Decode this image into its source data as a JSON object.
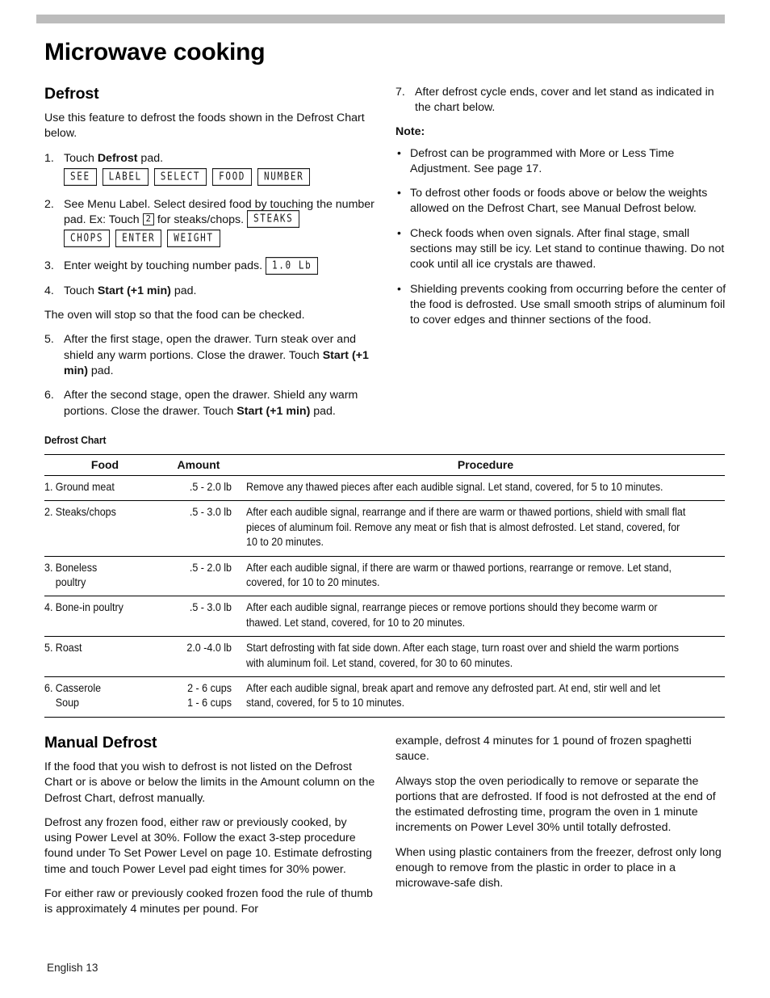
{
  "page_title": "Microwave cooking",
  "footer": "English 13",
  "defrost": {
    "heading": "Defrost",
    "intro": "Use this feature to defrost the foods shown in the Defrost Chart below.",
    "steps": [
      {
        "num": "1.",
        "text_before": "Touch ",
        "bold": "Defrost",
        "text_after": " pad."
      },
      {
        "num": "2.",
        "text": "See Menu Label. Select desired food by touching the number pad. Ex: Touch",
        "keycap": "2",
        "text2": "for steaks/chops."
      },
      {
        "num": "3.",
        "text": "Enter weight by touching number pads."
      },
      {
        "num": "4.",
        "text_before": "Touch ",
        "bold": "Start (+1 min)",
        "text_after": " pad."
      },
      {
        "num": "5.",
        "text_before": "After the first stage, open the drawer. Turn steak over and shield any warm portions. Close the drawer. Touch ",
        "bold": "Start (+1 min)",
        "text_after": " pad."
      },
      {
        "num": "6.",
        "text_before": "After the second stage, open the drawer. Shield any warm portions. Close the drawer. Touch ",
        "bold": "Start (+1 min)",
        "text_after": " pad."
      },
      {
        "num": "7.",
        "text": "After defrost cycle ends, cover and let stand as indicated in the chart below."
      }
    ],
    "after_step4": "The oven will stop so that the food can be checked.",
    "lcd_row1": [
      "SEE",
      "LABEL",
      "SELECT",
      "FOOD",
      "NUMBER"
    ],
    "lcd_steaks": "STEAKS",
    "lcd_row2": [
      "CHOPS",
      "ENTER",
      "WEIGHT"
    ],
    "lcd_weight": "1.0 Lb"
  },
  "note": {
    "heading": "Note:",
    "bullets": [
      "Defrost can be programmed with More or Less Time Adjustment. See page 17.",
      "To defrost other foods or foods above or below the weights allowed on the Defrost Chart, see Manual Defrost below.",
      "Check foods when oven signals. After final stage, small sections may still be icy. Let stand to continue thawing. Do not cook until all ice crystals are thawed.",
      "Shielding prevents cooking from occurring before the center of the food is defrosted. Use small smooth strips of aluminum foil to cover edges and thinner sections of the food."
    ]
  },
  "chart": {
    "title": "Defrost Chart",
    "columns": [
      "Food",
      "Amount",
      "Procedure"
    ],
    "rows": [
      {
        "num": "1.",
        "food": "Ground meat",
        "food_line2": "",
        "amount": ".5 - 2.0 lb",
        "amount_line2": "",
        "procedure": "Remove any thawed pieces after each audible signal. Let stand, covered, for 5 to 10 minutes."
      },
      {
        "num": "2.",
        "food": "Steaks/chops",
        "food_line2": "",
        "amount": ".5 - 3.0 lb",
        "amount_line2": "",
        "procedure": "After each audible signal, rearrange and if there are warm or thawed portions, shield with small flat pieces of aluminum foil. Remove any meat or fish that is almost defrosted. Let stand, covered, for 10 to 20 minutes."
      },
      {
        "num": "3.",
        "food": "Boneless",
        "food_line2": "poultry",
        "amount": ".5 - 2.0 lb",
        "amount_line2": "",
        "procedure": "After each audible signal, if there are warm or thawed portions, rearrange or remove. Let stand, covered, for 10 to 20 minutes."
      },
      {
        "num": "4.",
        "food": "Bone-in poultry",
        "food_line2": "",
        "amount": ".5 - 3.0 lb",
        "amount_line2": "",
        "procedure": "After each audible signal, rearrange pieces or remove portions should they become warm or thawed. Let stand, covered, for 10 to 20 minutes."
      },
      {
        "num": "5.",
        "food": "Roast",
        "food_line2": "",
        "amount": "2.0 -4.0 lb",
        "amount_line2": "",
        "procedure": "Start defrosting with fat side down. After each stage, turn roast over and shield the warm portions with aluminum foil. Let stand, covered, for 30 to 60 minutes."
      },
      {
        "num": "6.",
        "food": "Casserole",
        "food_line2": "Soup",
        "amount": "2 - 6 cups",
        "amount_line2": "1 - 6 cups",
        "procedure": "After each audible signal, break apart and remove any defrosted part. At end, stir well and let stand, covered, for 5 to 10 minutes."
      }
    ]
  },
  "manual_defrost": {
    "heading": "Manual Defrost",
    "left_paragraphs": [
      "If the food that you wish to defrost is not listed on the Defrost Chart or is above or below the limits in the Amount column on the Defrost Chart, defrost manually.",
      "Defrost any frozen food, either raw or previously cooked, by using Power Level at 30%. Follow the exact 3-step procedure found under To Set Power Level on page 10. Estimate defrosting time and touch Power Level pad eight times for 30% power.",
      "For either raw or previously cooked frozen food the rule of thumb is approximately 4 minutes per pound. For"
    ],
    "right_paragraphs": [
      "example, defrost 4 minutes for 1 pound of frozen spaghetti sauce.",
      "Always stop the oven periodically to remove or separate the portions that are defrosted. If food is not defrosted at the end of the estimated defrosting time, program the oven in 1 minute increments on Power Level 30% until totally defrosted.",
      "When using plastic containers from the freezer, defrost only long enough to remove from the plastic in order to place in a microwave-safe dish."
    ]
  }
}
